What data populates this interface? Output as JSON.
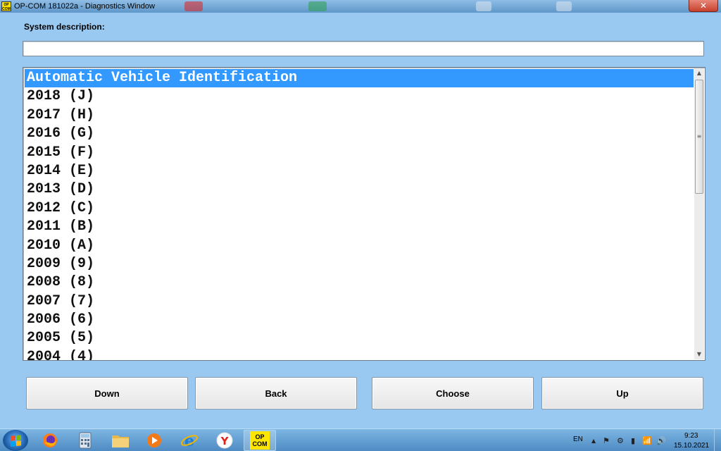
{
  "window": {
    "title": "OP-COM 181022a - Diagnostics Window",
    "app_icon_text": "OP COM",
    "close_glyph": "✕"
  },
  "system_description": {
    "label": "System description:",
    "value": ""
  },
  "list": {
    "items": [
      "Automatic Vehicle Identification",
      "2018 (J)",
      "2017 (H)",
      "2016 (G)",
      "2015 (F)",
      "2014 (E)",
      "2013 (D)",
      "2012 (C)",
      "2011 (B)",
      "2010 (A)",
      "2009 (9)",
      "2008 (8)",
      "2007 (7)",
      "2006 (6)",
      "2005 (5)",
      "2004 (4)"
    ],
    "selected_index": 0
  },
  "buttons": {
    "down": "Down",
    "back": "Back",
    "choose": "Choose",
    "up": "Up"
  },
  "taskbar": {
    "opcom_label_1": "OP",
    "opcom_label_2": "COM",
    "language": "EN",
    "time": "9:23",
    "date": "15.10.2021"
  },
  "colors": {
    "background": "#99c9f0",
    "selection": "#3399ff",
    "opcom_yellow": "#ffe600"
  }
}
